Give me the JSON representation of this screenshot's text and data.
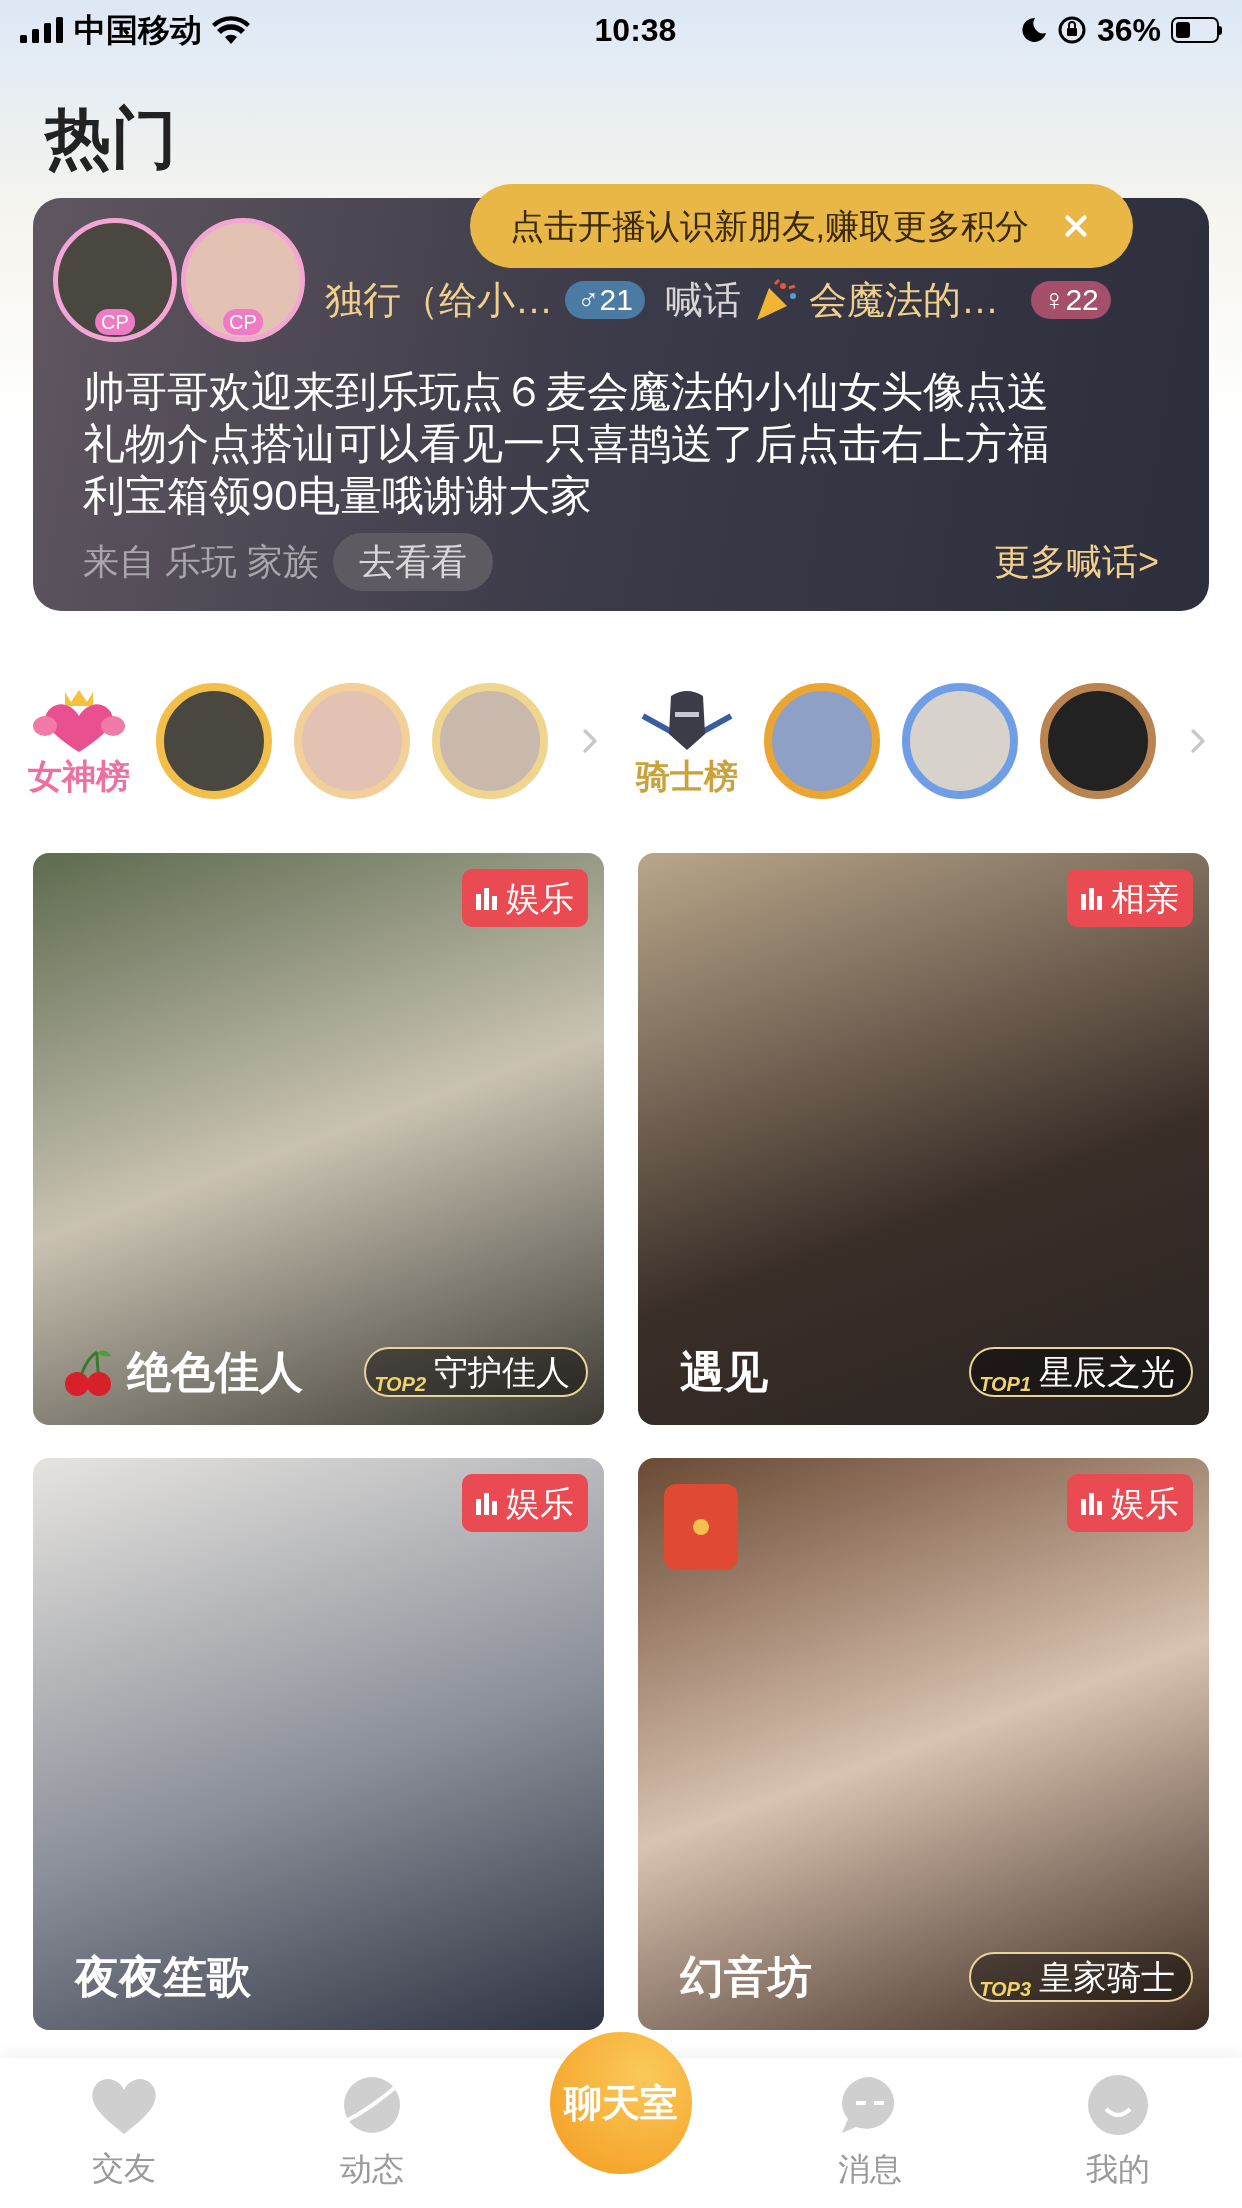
{
  "status_bar": {
    "carrier": "中国移动",
    "time": "10:38",
    "battery": "36%"
  },
  "title": "热门",
  "shout": {
    "tooltip": "点击开播认识新朋友,赚取更多积分",
    "avatars": [
      {
        "badge": "CP"
      },
      {
        "badge": "CP"
      }
    ],
    "sender": "独行（给小…",
    "sender_badge": "♂21",
    "verb": "喊话",
    "receiver": "会魔法的…",
    "receiver_badge": "♀22",
    "message": "帅哥哥欢迎来到乐玩点６麦会魔法的小仙女头像点送礼物介点搭讪可以看见一只喜鹊送了后点击右上方福利宝箱领90电量哦谢谢大家",
    "source": "来自 乐玩 家族",
    "go_button": "去看看",
    "more_link": "更多喊话>"
  },
  "rankings": [
    {
      "label": "女神榜",
      "kind": "goddess",
      "avatars": [
        {
          "color": "#f2c04a"
        },
        {
          "color": "#f3cf9a"
        },
        {
          "color": "#efd58e"
        }
      ]
    },
    {
      "label": "骑士榜",
      "kind": "knight",
      "avatars": [
        {
          "color": "#eba532"
        },
        {
          "color": "#6f9ee6"
        },
        {
          "color": "#b98450"
        }
      ]
    }
  ],
  "rooms": [
    {
      "title": "绝色佳人",
      "tag": "娱乐",
      "kind": "cherry",
      "badge": {
        "rank": "TOP2",
        "label": "守护佳人"
      }
    },
    {
      "title": "遇见",
      "tag": "相亲",
      "kind": "plain",
      "badge": {
        "rank": "TOP1",
        "label": "星辰之光"
      }
    },
    {
      "title": "夜夜笙歌",
      "tag": "娱乐",
      "kind": "plain"
    },
    {
      "title": "幻音坊",
      "tag": "娱乐",
      "kind": "red_packet",
      "badge": {
        "rank": "TOP3",
        "label": "皇家骑士"
      }
    }
  ],
  "nav": [
    {
      "label": "交友",
      "kind": "heart",
      "selected": false
    },
    {
      "label": "动态",
      "kind": "planet",
      "selected": false
    },
    {
      "label": "聊天室",
      "kind": "center",
      "selected": true
    },
    {
      "label": "消息",
      "kind": "chat",
      "selected": false
    },
    {
      "label": "我的",
      "kind": "smile",
      "selected": false
    }
  ]
}
